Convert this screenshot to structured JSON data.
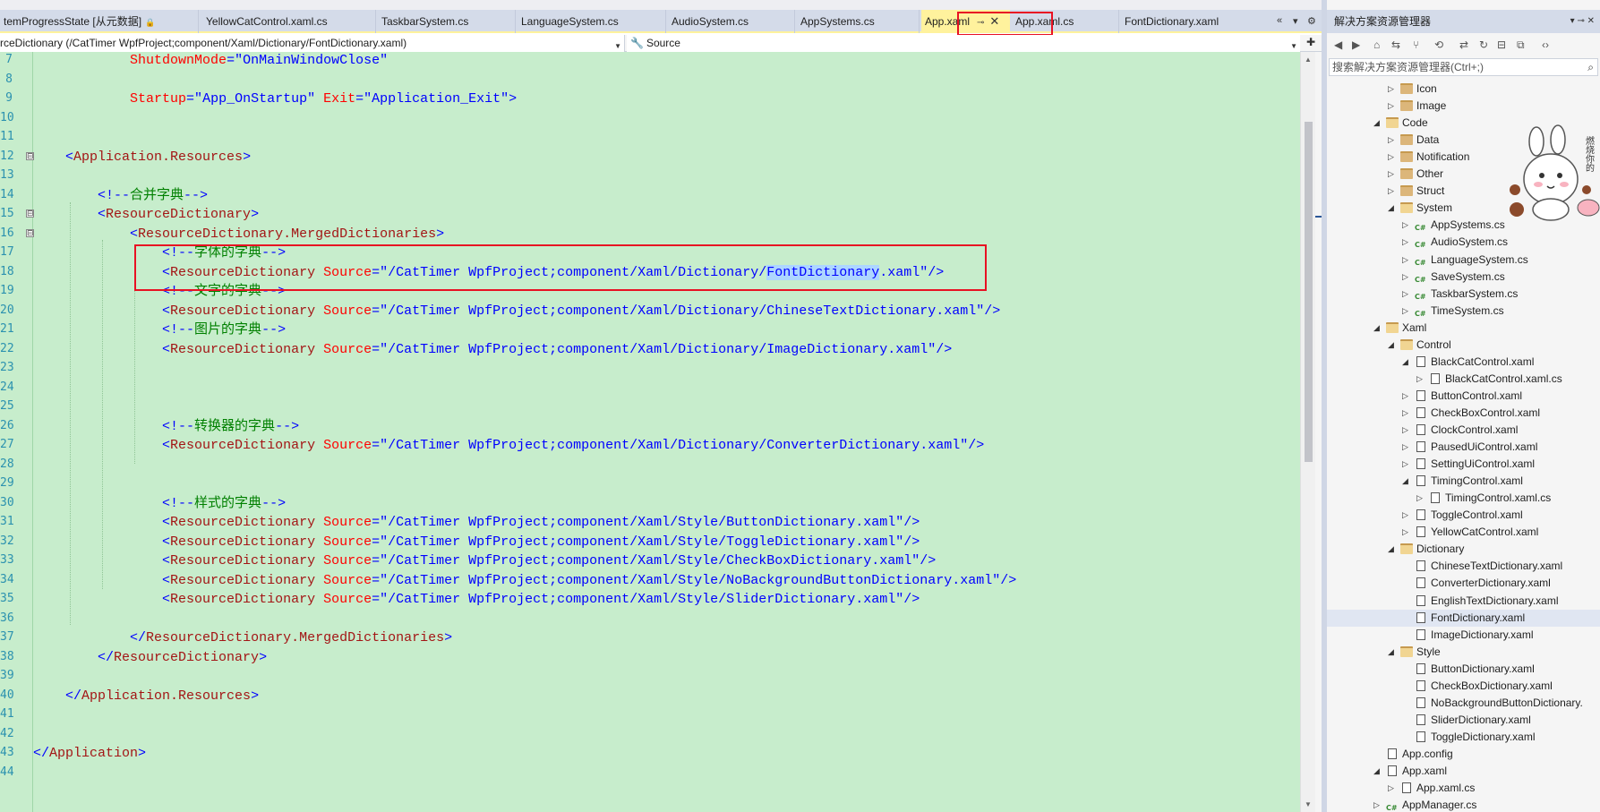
{
  "tabs": [
    {
      "label": "temProgressState [从元数据]",
      "lock": "🔒"
    },
    {
      "label": "YellowCatControl.xaml.cs"
    },
    {
      "label": "TaskbarSystem.cs"
    },
    {
      "label": "LanguageSystem.cs"
    },
    {
      "label": "AudioSystem.cs"
    },
    {
      "label": "AppSystems.cs"
    },
    {
      "label": "App.xaml",
      "active": true,
      "pin": "⊸",
      "close": "✕"
    },
    {
      "label": "App.xaml.cs"
    },
    {
      "label": "FontDictionary.xaml"
    }
  ],
  "tab_tools": {
    "overflow": "«",
    "dropdown": "▾",
    "settings": "⚙"
  },
  "navbar": {
    "element": "rceDictionary (/CatTimer WpfProject;component/Xaml/Dictionary/FontDictionary.xaml)",
    "member_icon": "wrench-icon",
    "member": "Source",
    "dropdown": "▼",
    "split": "✚"
  },
  "editor": {
    "line_numbers": [
      "7",
      "8",
      "9",
      "10",
      "11",
      "12",
      "13",
      "14",
      "15",
      "16",
      "17",
      "18",
      "19",
      "20",
      "21",
      "22",
      "23",
      "24",
      "25",
      "26",
      "27",
      "28",
      "29",
      "30",
      "31",
      "32",
      "33",
      "34",
      "35",
      "36",
      "37",
      "38",
      "39",
      "40",
      "41",
      "42",
      "43",
      "44"
    ],
    "lines": [
      {
        "indent": "            ",
        "parts": [
          {
            "k": "a",
            "s": "ShutdownMode"
          },
          {
            "k": "p",
            "s": "=\""
          },
          {
            "k": "v",
            "s": "OnMainWindowClose"
          },
          {
            "k": "p",
            "s": "\""
          }
        ]
      },
      {
        "indent": "",
        "parts": []
      },
      {
        "indent": "            ",
        "parts": [
          {
            "k": "a",
            "s": "Startup"
          },
          {
            "k": "p",
            "s": "=\""
          },
          {
            "k": "v",
            "s": "App_OnStartup"
          },
          {
            "k": "p",
            "s": "\" "
          },
          {
            "k": "a",
            "s": "Exit"
          },
          {
            "k": "p",
            "s": "=\""
          },
          {
            "k": "v",
            "s": "Application_Exit"
          },
          {
            "k": "p",
            "s": "\">"
          }
        ]
      },
      {
        "indent": "",
        "parts": []
      },
      {
        "indent": "",
        "parts": []
      },
      {
        "indent": "    ",
        "parts": [
          {
            "k": "p",
            "s": "<"
          },
          {
            "k": "t",
            "s": "Application.Resources"
          },
          {
            "k": "p",
            "s": ">"
          }
        ]
      },
      {
        "indent": "",
        "parts": []
      },
      {
        "indent": "        ",
        "parts": [
          {
            "k": "p",
            "s": "<!--"
          },
          {
            "k": "c",
            "s": "合并字典"
          },
          {
            "k": "p",
            "s": "-->"
          }
        ]
      },
      {
        "indent": "        ",
        "parts": [
          {
            "k": "p",
            "s": "<"
          },
          {
            "k": "t",
            "s": "ResourceDictionary"
          },
          {
            "k": "p",
            "s": ">"
          }
        ]
      },
      {
        "indent": "            ",
        "parts": [
          {
            "k": "p",
            "s": "<"
          },
          {
            "k": "t",
            "s": "ResourceDictionary.MergedDictionaries"
          },
          {
            "k": "p",
            "s": ">"
          }
        ]
      },
      {
        "indent": "                ",
        "parts": [
          {
            "k": "p",
            "s": "<!--"
          },
          {
            "k": "c",
            "s": "字体的字典"
          },
          {
            "k": "p",
            "s": "-->"
          }
        ]
      },
      {
        "indent": "                ",
        "parts": [
          {
            "k": "p",
            "s": "<"
          },
          {
            "k": "t",
            "s": "ResourceDictionary"
          },
          {
            "k": "p",
            "s": " "
          },
          {
            "k": "a",
            "s": "Source"
          },
          {
            "k": "p",
            "s": "=\""
          },
          {
            "k": "v",
            "s": "/CatTimer WpfProject;component/Xaml/Dictionary/"
          },
          {
            "k": "sel",
            "s": "FontDictionary"
          },
          {
            "k": "v",
            "s": ".xaml"
          },
          {
            "k": "p",
            "s": "\"/>"
          }
        ]
      },
      {
        "indent": "                ",
        "parts": [
          {
            "k": "p",
            "s": "<!--"
          },
          {
            "k": "c",
            "s": "文字的字典"
          },
          {
            "k": "p",
            "s": "-->"
          }
        ]
      },
      {
        "indent": "                ",
        "parts": [
          {
            "k": "p",
            "s": "<"
          },
          {
            "k": "t",
            "s": "ResourceDictionary"
          },
          {
            "k": "p",
            "s": " "
          },
          {
            "k": "a",
            "s": "Source"
          },
          {
            "k": "p",
            "s": "=\""
          },
          {
            "k": "v",
            "s": "/CatTimer WpfProject;component/Xaml/Dictionary/ChineseTextDictionary.xaml"
          },
          {
            "k": "p",
            "s": "\"/>"
          }
        ]
      },
      {
        "indent": "                ",
        "parts": [
          {
            "k": "p",
            "s": "<!--"
          },
          {
            "k": "c",
            "s": "图片的字典"
          },
          {
            "k": "p",
            "s": "-->"
          }
        ]
      },
      {
        "indent": "                ",
        "parts": [
          {
            "k": "p",
            "s": "<"
          },
          {
            "k": "t",
            "s": "ResourceDictionary"
          },
          {
            "k": "p",
            "s": " "
          },
          {
            "k": "a",
            "s": "Source"
          },
          {
            "k": "p",
            "s": "=\""
          },
          {
            "k": "v",
            "s": "/CatTimer WpfProject;component/Xaml/Dictionary/ImageDictionary.xaml"
          },
          {
            "k": "p",
            "s": "\"/>"
          }
        ]
      },
      {
        "indent": "",
        "parts": []
      },
      {
        "indent": "",
        "parts": []
      },
      {
        "indent": "",
        "parts": []
      },
      {
        "indent": "                ",
        "parts": [
          {
            "k": "p",
            "s": "<!--"
          },
          {
            "k": "c",
            "s": "转换器的字典"
          },
          {
            "k": "p",
            "s": "-->"
          }
        ]
      },
      {
        "indent": "                ",
        "parts": [
          {
            "k": "p",
            "s": "<"
          },
          {
            "k": "t",
            "s": "ResourceDictionary"
          },
          {
            "k": "p",
            "s": " "
          },
          {
            "k": "a",
            "s": "Source"
          },
          {
            "k": "p",
            "s": "=\""
          },
          {
            "k": "v",
            "s": "/CatTimer WpfProject;component/Xaml/Dictionary/ConverterDictionary.xaml"
          },
          {
            "k": "p",
            "s": "\"/>"
          }
        ]
      },
      {
        "indent": "",
        "parts": []
      },
      {
        "indent": "",
        "parts": []
      },
      {
        "indent": "                ",
        "parts": [
          {
            "k": "p",
            "s": "<!--"
          },
          {
            "k": "c",
            "s": "样式的字典"
          },
          {
            "k": "p",
            "s": "-->"
          }
        ]
      },
      {
        "indent": "                ",
        "parts": [
          {
            "k": "p",
            "s": "<"
          },
          {
            "k": "t",
            "s": "ResourceDictionary"
          },
          {
            "k": "p",
            "s": " "
          },
          {
            "k": "a",
            "s": "Source"
          },
          {
            "k": "p",
            "s": "=\""
          },
          {
            "k": "v",
            "s": "/CatTimer WpfProject;component/Xaml/Style/ButtonDictionary.xaml"
          },
          {
            "k": "p",
            "s": "\"/>"
          }
        ]
      },
      {
        "indent": "                ",
        "parts": [
          {
            "k": "p",
            "s": "<"
          },
          {
            "k": "t",
            "s": "ResourceDictionary"
          },
          {
            "k": "p",
            "s": " "
          },
          {
            "k": "a",
            "s": "Source"
          },
          {
            "k": "p",
            "s": "=\""
          },
          {
            "k": "v",
            "s": "/CatTimer WpfProject;component/Xaml/Style/ToggleDictionary.xaml"
          },
          {
            "k": "p",
            "s": "\"/>"
          }
        ]
      },
      {
        "indent": "                ",
        "parts": [
          {
            "k": "p",
            "s": "<"
          },
          {
            "k": "t",
            "s": "ResourceDictionary"
          },
          {
            "k": "p",
            "s": " "
          },
          {
            "k": "a",
            "s": "Source"
          },
          {
            "k": "p",
            "s": "=\""
          },
          {
            "k": "v",
            "s": "/CatTimer WpfProject;component/Xaml/Style/CheckBoxDictionary.xaml"
          },
          {
            "k": "p",
            "s": "\"/>"
          }
        ]
      },
      {
        "indent": "                ",
        "parts": [
          {
            "k": "p",
            "s": "<"
          },
          {
            "k": "t",
            "s": "ResourceDictionary"
          },
          {
            "k": "p",
            "s": " "
          },
          {
            "k": "a",
            "s": "Source"
          },
          {
            "k": "p",
            "s": "=\""
          },
          {
            "k": "v",
            "s": "/CatTimer WpfProject;component/Xaml/Style/NoBackgroundButtonDictionary.xaml"
          },
          {
            "k": "p",
            "s": "\"/>"
          }
        ]
      },
      {
        "indent": "                ",
        "parts": [
          {
            "k": "p",
            "s": "<"
          },
          {
            "k": "t",
            "s": "ResourceDictionary"
          },
          {
            "k": "p",
            "s": " "
          },
          {
            "k": "a",
            "s": "Source"
          },
          {
            "k": "p",
            "s": "=\""
          },
          {
            "k": "v",
            "s": "/CatTimer WpfProject;component/Xaml/Style/SliderDictionary.xaml"
          },
          {
            "k": "p",
            "s": "\"/>"
          }
        ]
      },
      {
        "indent": "",
        "parts": []
      },
      {
        "indent": "            ",
        "parts": [
          {
            "k": "p",
            "s": "</"
          },
          {
            "k": "t",
            "s": "ResourceDictionary.MergedDictionaries"
          },
          {
            "k": "p",
            "s": ">"
          }
        ]
      },
      {
        "indent": "        ",
        "parts": [
          {
            "k": "p",
            "s": "</"
          },
          {
            "k": "t",
            "s": "ResourceDictionary"
          },
          {
            "k": "p",
            "s": ">"
          }
        ]
      },
      {
        "indent": "",
        "parts": []
      },
      {
        "indent": "    ",
        "parts": [
          {
            "k": "p",
            "s": "</"
          },
          {
            "k": "t",
            "s": "Application.Resources"
          },
          {
            "k": "p",
            "s": ">"
          }
        ]
      },
      {
        "indent": "",
        "parts": []
      },
      {
        "indent": "",
        "parts": []
      },
      {
        "indent": "",
        "parts": [
          {
            "k": "p",
            "s": "</"
          },
          {
            "k": "t",
            "s": "Application"
          },
          {
            "k": "p",
            "s": ">"
          }
        ]
      },
      {
        "indent": "",
        "parts": []
      }
    ],
    "fold_markers": [
      "⊟",
      "⊟",
      "⊟"
    ]
  },
  "solution_explorer": {
    "title": "解决方案资源管理器",
    "title_tools": "▾ ⊸ ✕",
    "search_placeholder": "搜索解决方案资源管理器(Ctrl+;)",
    "toolbar_icons": [
      "back-icon",
      "forward-icon",
      "home-icon",
      "switch-view-icon",
      "git-icon",
      "history-icon",
      "sync-icon",
      "refresh-icon",
      "collapse-icon",
      "show-all-icon",
      "code-icon"
    ],
    "tree": [
      {
        "label": "Icon",
        "type": "folder",
        "level": 2,
        "arrow": "▷"
      },
      {
        "label": "Image",
        "type": "folder",
        "level": 2,
        "arrow": "▷"
      },
      {
        "label": "Code",
        "type": "folder-open",
        "level": 1,
        "arrow": "◢"
      },
      {
        "label": "Data",
        "type": "folder",
        "level": 2,
        "arrow": "▷"
      },
      {
        "label": "Notification",
        "type": "folder",
        "level": 2,
        "arrow": "▷"
      },
      {
        "label": "Other",
        "type": "folder",
        "level": 2,
        "arrow": "▷"
      },
      {
        "label": "Struct",
        "type": "folder",
        "level": 2,
        "arrow": "▷"
      },
      {
        "label": "System",
        "type": "folder-open",
        "level": 2,
        "arrow": "◢"
      },
      {
        "label": "AppSystems.cs",
        "type": "cs",
        "level": 3,
        "arrow": "▷"
      },
      {
        "label": "AudioSystem.cs",
        "type": "cs",
        "level": 3,
        "arrow": "▷"
      },
      {
        "label": "LanguageSystem.cs",
        "type": "cs",
        "level": 3,
        "arrow": "▷"
      },
      {
        "label": "SaveSystem.cs",
        "type": "cs",
        "level": 3,
        "arrow": "▷"
      },
      {
        "label": "TaskbarSystem.cs",
        "type": "cs",
        "level": 3,
        "arrow": "▷"
      },
      {
        "label": "TimeSystem.cs",
        "type": "cs",
        "level": 3,
        "arrow": "▷"
      },
      {
        "label": "Xaml",
        "type": "folder-open",
        "level": 1,
        "arrow": "◢"
      },
      {
        "label": "Control",
        "type": "folder-open",
        "level": 2,
        "arrow": "◢"
      },
      {
        "label": "BlackCatControl.xaml",
        "type": "xaml",
        "level": 3,
        "arrow": "◢"
      },
      {
        "label": "BlackCatControl.xaml.cs",
        "type": "xaml",
        "level": 4,
        "arrow": "▷"
      },
      {
        "label": "ButtonControl.xaml",
        "type": "xaml",
        "level": 3,
        "arrow": "▷"
      },
      {
        "label": "CheckBoxControl.xaml",
        "type": "xaml",
        "level": 3,
        "arrow": "▷"
      },
      {
        "label": "ClockControl.xaml",
        "type": "xaml",
        "level": 3,
        "arrow": "▷"
      },
      {
        "label": "PausedUiControl.xaml",
        "type": "xaml",
        "level": 3,
        "arrow": "▷"
      },
      {
        "label": "SettingUiControl.xaml",
        "type": "xaml",
        "level": 3,
        "arrow": "▷"
      },
      {
        "label": "TimingControl.xaml",
        "type": "xaml",
        "level": 3,
        "arrow": "◢"
      },
      {
        "label": "TimingControl.xaml.cs",
        "type": "xaml",
        "level": 4,
        "arrow": "▷"
      },
      {
        "label": "ToggleControl.xaml",
        "type": "xaml",
        "level": 3,
        "arrow": "▷"
      },
      {
        "label": "YellowCatControl.xaml",
        "type": "xaml",
        "level": 3,
        "arrow": "▷"
      },
      {
        "label": "Dictionary",
        "type": "folder-open",
        "level": 2,
        "arrow": "◢"
      },
      {
        "label": "ChineseTextDictionary.xaml",
        "type": "xaml",
        "level": 3,
        "arrow": ""
      },
      {
        "label": "ConverterDictionary.xaml",
        "type": "xaml",
        "level": 3,
        "arrow": ""
      },
      {
        "label": "EnglishTextDictionary.xaml",
        "type": "xaml",
        "level": 3,
        "arrow": ""
      },
      {
        "label": "FontDictionary.xaml",
        "type": "xaml",
        "level": 3,
        "arrow": "",
        "selected": true
      },
      {
        "label": "ImageDictionary.xaml",
        "type": "xaml",
        "level": 3,
        "arrow": ""
      },
      {
        "label": "Style",
        "type": "folder-open",
        "level": 2,
        "arrow": "◢"
      },
      {
        "label": "ButtonDictionary.xaml",
        "type": "xaml",
        "level": 3,
        "arrow": ""
      },
      {
        "label": "CheckBoxDictionary.xaml",
        "type": "xaml",
        "level": 3,
        "arrow": ""
      },
      {
        "label": "NoBackgroundButtonDictionary.",
        "type": "xaml",
        "level": 3,
        "arrow": ""
      },
      {
        "label": "SliderDictionary.xaml",
        "type": "xaml",
        "level": 3,
        "arrow": ""
      },
      {
        "label": "ToggleDictionary.xaml",
        "type": "xaml",
        "level": 3,
        "arrow": ""
      },
      {
        "label": "App.config",
        "type": "proj",
        "level": 1,
        "arrow": ""
      },
      {
        "label": "App.xaml",
        "type": "proj",
        "level": 1,
        "arrow": "◢"
      },
      {
        "label": "App.xaml.cs",
        "type": "xaml",
        "level": 2,
        "arrow": "▷"
      },
      {
        "label": "AppManager.cs",
        "type": "cs",
        "level": 1,
        "arrow": "▷"
      }
    ],
    "sticker_text": "燃烧你的"
  },
  "colors": {
    "editor_bg": "#c7edcc",
    "active_tab": "#fff29d",
    "highlight_box": "#e81123",
    "selection": "#add6ff"
  }
}
